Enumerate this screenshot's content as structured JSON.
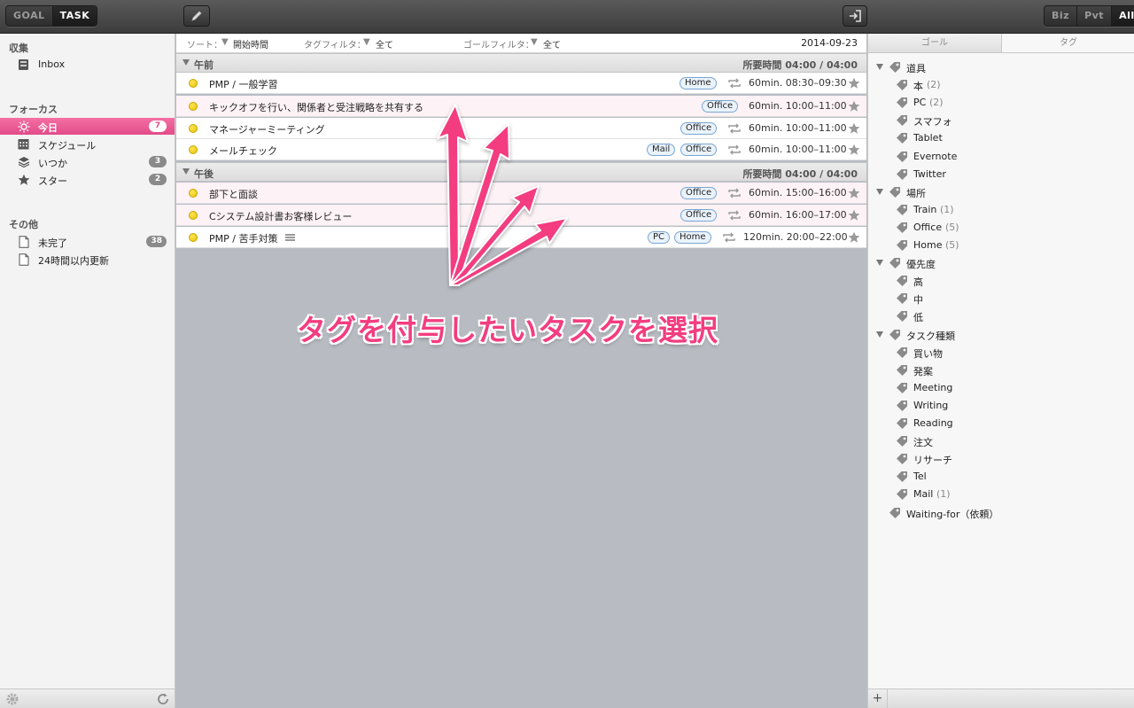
{
  "toolbar": {
    "mode_goal": "GOAL",
    "mode_task": "TASK",
    "scope_biz": "Biz",
    "scope_pvt": "Pvt",
    "scope_all": "All"
  },
  "sidebar": {
    "collect_title": "収集",
    "inbox": "Inbox",
    "focus_title": "フォーカス",
    "today": "今日",
    "today_count": "7",
    "schedule": "スケジュール",
    "someday": "いつか",
    "someday_count": "3",
    "star": "スター",
    "star_count": "2",
    "other_title": "その他",
    "incomplete": "未完了",
    "incomplete_count": "38",
    "updated24": "24時間以内更新"
  },
  "filters": {
    "sort_label": "ソート：",
    "sort_value": "開始時間",
    "tag_label": "タグフィルタ：",
    "tag_value": "全て",
    "goal_label": "ゴールフィルタ：",
    "goal_value": "全て",
    "date": "2014-09-23"
  },
  "groups": {
    "am": {
      "label": "午前",
      "required_label": "所要時間",
      "required": "04:00 / 04:00"
    },
    "pm": {
      "label": "午後",
      "required_label": "所要時間",
      "required": "04:00 / 04:00"
    }
  },
  "tasks": [
    {
      "title": "PMP / 一般学習",
      "tags": [
        "Home"
      ],
      "duration": "60min.",
      "time": "08:30–09:30"
    },
    {
      "title": "キックオフを行い、関係者と受注戦略を共有する",
      "tags": [
        "Office"
      ],
      "duration": "60min.",
      "time": "10:00–11:00"
    },
    {
      "title": "マネージャーミーティング",
      "tags": [
        "Office"
      ],
      "duration": "60min.",
      "time": "10:00–11:00"
    },
    {
      "title": "メールチェック",
      "tags": [
        "Mail",
        "Office"
      ],
      "duration": "60min.",
      "time": "10:00–11:00"
    },
    {
      "title": "部下と面談",
      "tags": [
        "Office"
      ],
      "duration": "60min.",
      "time": "15:00–16:00"
    },
    {
      "title": "Cシステム設計書お客様レビュー",
      "tags": [
        "Office"
      ],
      "duration": "60min.",
      "time": "16:00–17:00"
    },
    {
      "title": "PMP / 苦手対策",
      "tags": [
        "PC",
        "Home"
      ],
      "duration": "120min.",
      "time": "20:00–22:00"
    }
  ],
  "annotation": "タグを付与したいタスクを選択",
  "right_panel": {
    "tab_goal": "ゴール",
    "tab_tag": "タグ",
    "tree": [
      {
        "label": "道具",
        "count": "",
        "level": 0
      },
      {
        "label": "本",
        "count": "(2)",
        "level": 1
      },
      {
        "label": "PC",
        "count": "(2)",
        "level": 1
      },
      {
        "label": "スマフォ",
        "count": "",
        "level": 1
      },
      {
        "label": "Tablet",
        "count": "",
        "level": 1
      },
      {
        "label": "Evernote",
        "count": "",
        "level": 1
      },
      {
        "label": "Twitter",
        "count": "",
        "level": 1
      },
      {
        "label": "場所",
        "count": "",
        "level": 0
      },
      {
        "label": "Train",
        "count": "(1)",
        "level": 1
      },
      {
        "label": "Office",
        "count": "(5)",
        "level": 1
      },
      {
        "label": "Home",
        "count": "(5)",
        "level": 1
      },
      {
        "label": "優先度",
        "count": "",
        "level": 0
      },
      {
        "label": "高",
        "count": "",
        "level": 1
      },
      {
        "label": "中",
        "count": "",
        "level": 1
      },
      {
        "label": "低",
        "count": "",
        "level": 1
      },
      {
        "label": "タスク種類",
        "count": "",
        "level": 0
      },
      {
        "label": "買い物",
        "count": "",
        "level": 1
      },
      {
        "label": "発案",
        "count": "",
        "level": 1
      },
      {
        "label": "Meeting",
        "count": "",
        "level": 1
      },
      {
        "label": "Writing",
        "count": "",
        "level": 1
      },
      {
        "label": "Reading",
        "count": "",
        "level": 1
      },
      {
        "label": "注文",
        "count": "",
        "level": 1
      },
      {
        "label": "リサーチ",
        "count": "",
        "level": 1
      },
      {
        "label": "Tel",
        "count": "",
        "level": 1
      },
      {
        "label": "Mail",
        "count": "(1)",
        "level": 1
      },
      {
        "label": "Waiting-for（依頼）",
        "count": "",
        "level": 0,
        "leaf": true
      }
    ],
    "add": "+"
  },
  "colors": {
    "accent": "#e24b88",
    "tag_border": "#7aa6d1",
    "annotation": "#f33d80"
  }
}
